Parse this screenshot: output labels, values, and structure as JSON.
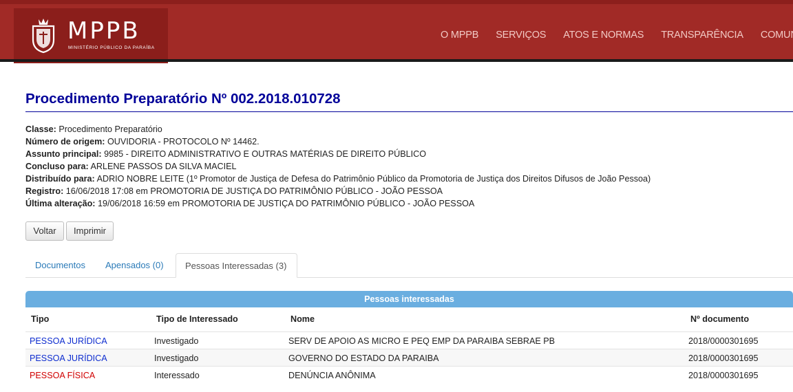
{
  "header": {
    "logo_title": "MPPB",
    "logo_subtitle": "MINISTÉRIO PÚBLICO DA PARAÍBA",
    "nav": [
      "O MPPB",
      "SERVIÇOS",
      "ATOS E NORMAS",
      "TRANSPARÊNCIA",
      "COMUNICA"
    ]
  },
  "page_title": "Procedimento Preparatório Nº 002.2018.010728",
  "info": [
    {
      "label": "Classe:",
      "value": "Procedimento Preparatório"
    },
    {
      "label": "Número de origem:",
      "value": "OUVIDORIA - PROTOCOLO Nº 14462."
    },
    {
      "label": "Assunto principal:",
      "value": "9985 - DIREITO ADMINISTRATIVO E OUTRAS MATÉRIAS DE DIREITO PÚBLICO"
    },
    {
      "label": "Concluso para:",
      "value": "ARLENE PASSOS DA SILVA MACIEL"
    },
    {
      "label": "Distribuído para:",
      "value": "ADRIO NOBRE LEITE (1º Promotor de Justiça de Defesa do Patrimônio Público da Promotoria de Justiça dos Direitos Difusos de João Pessoa)"
    },
    {
      "label": "Registro:",
      "value": "16/06/2018 17:08 em PROMOTORIA DE JUSTIÇA DO PATRIMÔNIO PÚBLICO - JOÃO PESSOA"
    },
    {
      "label": "Última alteração:",
      "value": "19/06/2018 16:59 em PROMOTORIA DE JUSTIÇA DO PATRIMÔNIO PÚBLICO - JOÃO PESSOA"
    }
  ],
  "buttons": {
    "voltar": "Voltar",
    "imprimir": "Imprimir"
  },
  "tabs": {
    "documentos": "Documentos",
    "apensados": "Apensados (0)",
    "pessoas": "Pessoas Interessadas (3)"
  },
  "table": {
    "caption": "Pessoas interessadas",
    "headers": [
      "Tipo",
      "Tipo de Interessado",
      "Nome",
      "Nº documento"
    ],
    "rows": [
      {
        "tipo": "PESSOA JURÍDICA",
        "interessado": "Investigado",
        "nome": "SERV DE APOIO AS MICRO E PEQ EMP DA PARAIBA SEBRAE PB",
        "documento": "2018/0000301695"
      },
      {
        "tipo": "PESSOA JURÍDICA",
        "interessado": "Investigado",
        "nome": "GOVERNO DO ESTADO DA PARAIBA",
        "documento": "2018/0000301695"
      },
      {
        "tipo": "PESSOA FÍSICA",
        "interessado": "Interessado",
        "nome": "DENÚNCIA ANÔNIMA",
        "documento": "2018/0000301695"
      }
    ]
  },
  "colors": {
    "header_red": "#a12a26",
    "title_blue": "#000099",
    "juridica_blue": "#0d2ccf",
    "fisica_red": "#d00000",
    "table_head": "#6aaee0"
  }
}
